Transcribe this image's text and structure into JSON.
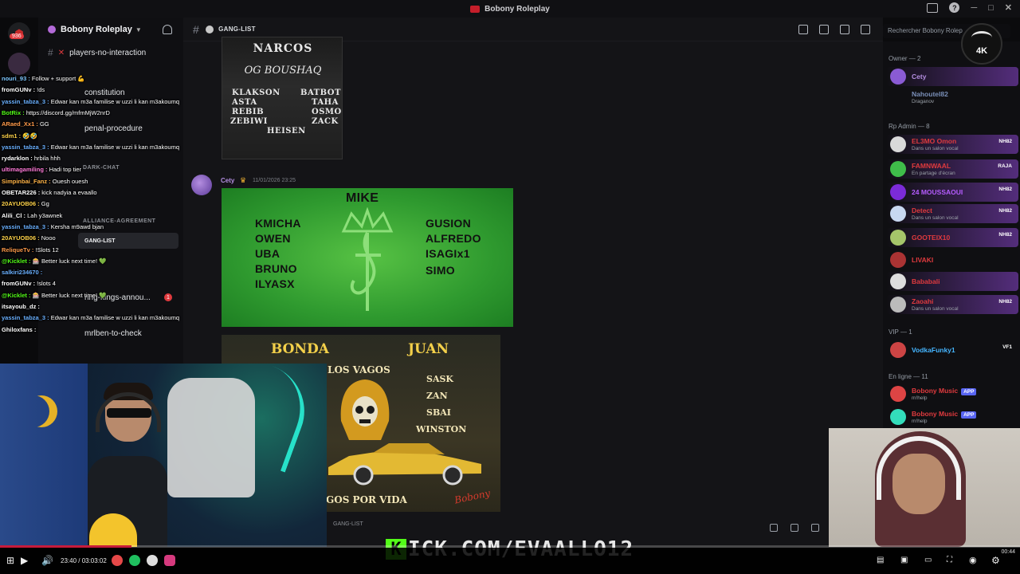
{
  "window": {
    "title": "Bobony Roleplay"
  },
  "rail": {
    "badge": "936"
  },
  "server": {
    "name": "Bobony Roleplay"
  },
  "channels": {
    "top": "players-no-interaction",
    "items": [
      "constitution",
      "penal-procedure",
      "ring-kings-annou...",
      "mrlben-to-check"
    ],
    "categories": [
      "DARK-CHAT",
      "ALLIANCE-AGREEMENT",
      "GANG-LIST"
    ],
    "active": "GANG-LIST",
    "ring_badge": "1"
  },
  "chat": [
    {
      "u": "nouri_93 :",
      "t": " Follow + support 💪",
      "c": "#7ec8ff"
    },
    {
      "u": "fromGUNv :",
      "t": " !ds",
      "c": "#ffffff"
    },
    {
      "u": "yassin_tabza_3 :",
      "t": " Edwar kan m3a familise w uzzi li kan m3akoumq",
      "c": "#6ab0ff"
    },
    {
      "u": "BotRix :",
      "t": " https://discord.gg/mfmMjW2nrD",
      "c": "#53fc18"
    },
    {
      "u": "ARaed_Xx1 :",
      "t": " GG",
      "c": "#ff9a4a"
    },
    {
      "u": "sdm1 :",
      "t": " 🤣🤣",
      "c": "#ffd34a"
    },
    {
      "u": "yassin_tabza_3 :",
      "t": " Edwar kan m3a familise w uzzi li kan m3akoumq",
      "c": "#6ab0ff"
    },
    {
      "u": "rydarklon :",
      "t": " hrbila hhh",
      "c": "#ffffff"
    },
    {
      "u": "ultimagamiling :",
      "t": " Hadi top tier",
      "c": "#ff7ad9"
    },
    {
      "u": "Simpinbai_Fanz :",
      "t": " Ouesh ouesh",
      "c": "#ffb347"
    },
    {
      "u": "OBETAR226 :",
      "t": " kick nadyia a evaallo",
      "c": "#ffffff"
    },
    {
      "u": "20AYUOB06 :",
      "t": " Gg",
      "c": "#ffd34a"
    },
    {
      "u": "Alili_Cl :",
      "t": " Lah y3awnek",
      "c": "#ffffff"
    },
    {
      "u": "yassin_tabza_3 :",
      "t": " Kersha m9awd bjan",
      "c": "#6ab0ff"
    },
    {
      "u": "20AYUOB06 :",
      "t": " Nooo",
      "c": "#ffd34a"
    },
    {
      "u": "ReliqueTv :",
      "t": " !Slots 12",
      "c": "#ff9a4a"
    },
    {
      "u": "@Kicklet :",
      "t": " 🎰 Better luck next time! 💚",
      "c": "#53fc18"
    },
    {
      "u": "salkiri234670 :",
      "t": "",
      "c": "#6ab0ff"
    },
    {
      "u": "fromGUNv :",
      "t": " !slots 4",
      "c": "#ffffff"
    },
    {
      "u": "@Kicklet :",
      "t": " 🎰 Better luck next time! 💚",
      "c": "#53fc18"
    },
    {
      "u": "itsayoub_dz :",
      "t": "",
      "c": "#ffffff"
    },
    {
      "u": "yassin_tabza_3 :",
      "t": " Edwar kan m3a familise w uzzi li kan m3akoumq",
      "c": "#6ab0ff"
    },
    {
      "u": "Ghiloxfans :",
      "t": "",
      "c": "#ffffff"
    }
  ],
  "header": {
    "channel": "GANG-LIST",
    "search_placeholder": "Rechercher Bobony Rolep"
  },
  "posts": {
    "narcos": {
      "title": "NARCOS",
      "big": "OG BOUSHAQ",
      "left": [
        "KLAKSON",
        "ASTA",
        "REBIB",
        "ZEBIWI"
      ],
      "right": [
        "BATBOT",
        "TAHA",
        "OSMO",
        "ZACK"
      ],
      "bottom": "HEISEN"
    },
    "message": {
      "author": "Cety",
      "time": "11/01/2026 23:25"
    },
    "mike": {
      "title": "MIKE",
      "left": [
        "KMICHA",
        "OWEN",
        "UBA",
        "BRUNO",
        "ILYASX"
      ],
      "right": [
        "GUSION",
        "ALFREDO",
        "ISAGIx1",
        "SIMO"
      ]
    },
    "vagos": {
      "left_name": "BONDA",
      "right_name": "JUAN",
      "arc": "LOS VAGOS",
      "members": [
        "SASK",
        "ZAN",
        "SBAI",
        "WINSTON"
      ],
      "footer": "GOS POR VIDA",
      "signature": "Bobony"
    },
    "bottom_channel": "GANG-LIST"
  },
  "members": {
    "owner_cat": "Owner — 2",
    "owners": [
      {
        "name": "Cety",
        "status": "",
        "color": "#b48ee0"
      },
      {
        "name": "Nahoutel82",
        "status": "Draganov",
        "color": "#7a8fb8"
      }
    ],
    "rp_admin_cat": "Rp Admin — 8",
    "admins": [
      {
        "name": "EL3MO Omon",
        "status": "Dans un salon vocal",
        "tag": "NH82",
        "color": "#e03a3e"
      },
      {
        "name": "FAMNWAAL",
        "status": "En partage d'écran",
        "tag": "RAJA",
        "color": "#e03a3e"
      },
      {
        "name": "24 MOUSSAOUI",
        "status": "",
        "tag": "NH82",
        "color": "#b55cff"
      },
      {
        "name": "Detect",
        "status": "Dans un salon vocal",
        "tag": "NH82",
        "color": "#e03a3e"
      },
      {
        "name": "GOOTEIX10",
        "status": "",
        "tag": "NH82",
        "color": "#e03a3e"
      },
      {
        "name": "LIVAKI",
        "status": "",
        "tag": "",
        "color": "#e03a3e"
      },
      {
        "name": "Bababali",
        "status": "",
        "tag": "",
        "color": "#e03a3e"
      },
      {
        "name": "Zaoahi",
        "status": "Dans un salon vocal",
        "tag": "NH82",
        "color": "#e03a3e"
      }
    ],
    "vip_cat": "VIP — 1",
    "vip": [
      {
        "name": "VodkaFunky1",
        "status": "",
        "tag": "VF1",
        "color": "#45b5ff"
      }
    ],
    "online_cat": "En ligne — 11",
    "online": [
      {
        "name": "Bobony Music",
        "status": "m!help",
        "tag": "APP",
        "color": "#e03a3e"
      },
      {
        "name": "Bobony Music",
        "status": "m!help",
        "tag": "APP",
        "color": "#e03a3e"
      }
    ]
  },
  "streamer_badge": "4K",
  "overlay": {
    "kick_k": "K",
    "kick_url": "ICK.COM/EVAALLO12"
  },
  "player": {
    "time": "23:40 / 03:03:02",
    "progress": 0.129,
    "clock": "00:44",
    "accent": "#c71b3b"
  },
  "colors": {
    "kick_green": "#53fc18",
    "mike_green": "#3fae35",
    "purple_highlight": "#8c46d2"
  }
}
